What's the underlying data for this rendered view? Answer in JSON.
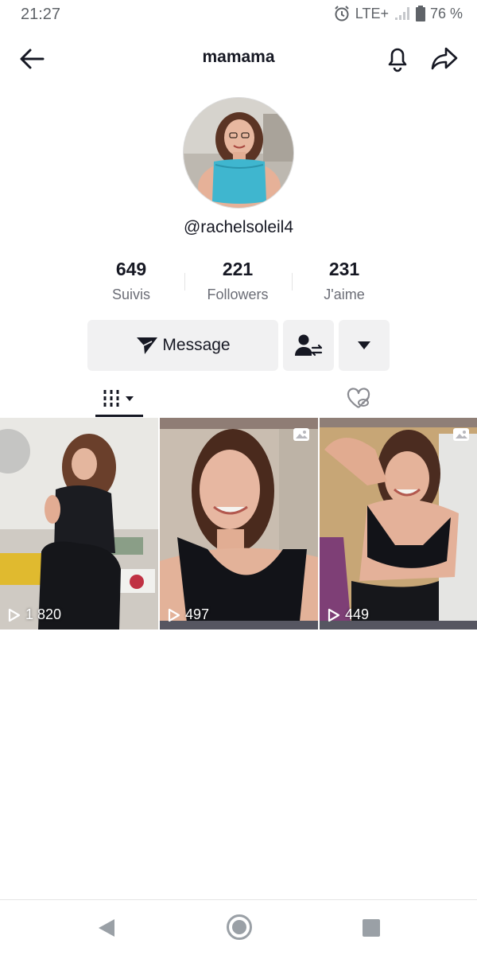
{
  "status_bar": {
    "time": "21:27",
    "network": "LTE+",
    "battery": "76 %",
    "icons": [
      "alarm-icon",
      "signal-icon",
      "battery-icon"
    ]
  },
  "header": {
    "title": "mamama",
    "icons": [
      "back-arrow-icon",
      "bell-icon",
      "share-icon"
    ]
  },
  "profile": {
    "username": "@rachelsoleil4",
    "stats": [
      {
        "value": "649",
        "label": "Suivis"
      },
      {
        "value": "221",
        "label": "Followers"
      },
      {
        "value": "231",
        "label": "J'aime"
      }
    ]
  },
  "actions": {
    "message_label": "Message",
    "icons": [
      "send-icon",
      "follow-swap-icon",
      "dropdown-triangle-icon"
    ]
  },
  "tabs": {
    "icons": [
      "grid-videos-icon",
      "liked-hidden-icon"
    ],
    "active": "videos"
  },
  "videos": [
    {
      "views": "1 820",
      "photo_badge": false
    },
    {
      "views": "497",
      "photo_badge": true
    },
    {
      "views": "449",
      "photo_badge": true
    }
  ],
  "nav_bar": {
    "icons": [
      "nav-back-icon",
      "nav-home-icon",
      "nav-recent-icon"
    ]
  },
  "colors": {
    "text_primary": "#161823",
    "text_secondary": "#6b6d76",
    "button_bg": "#f1f1f2",
    "status_gray": "#5f6368"
  }
}
